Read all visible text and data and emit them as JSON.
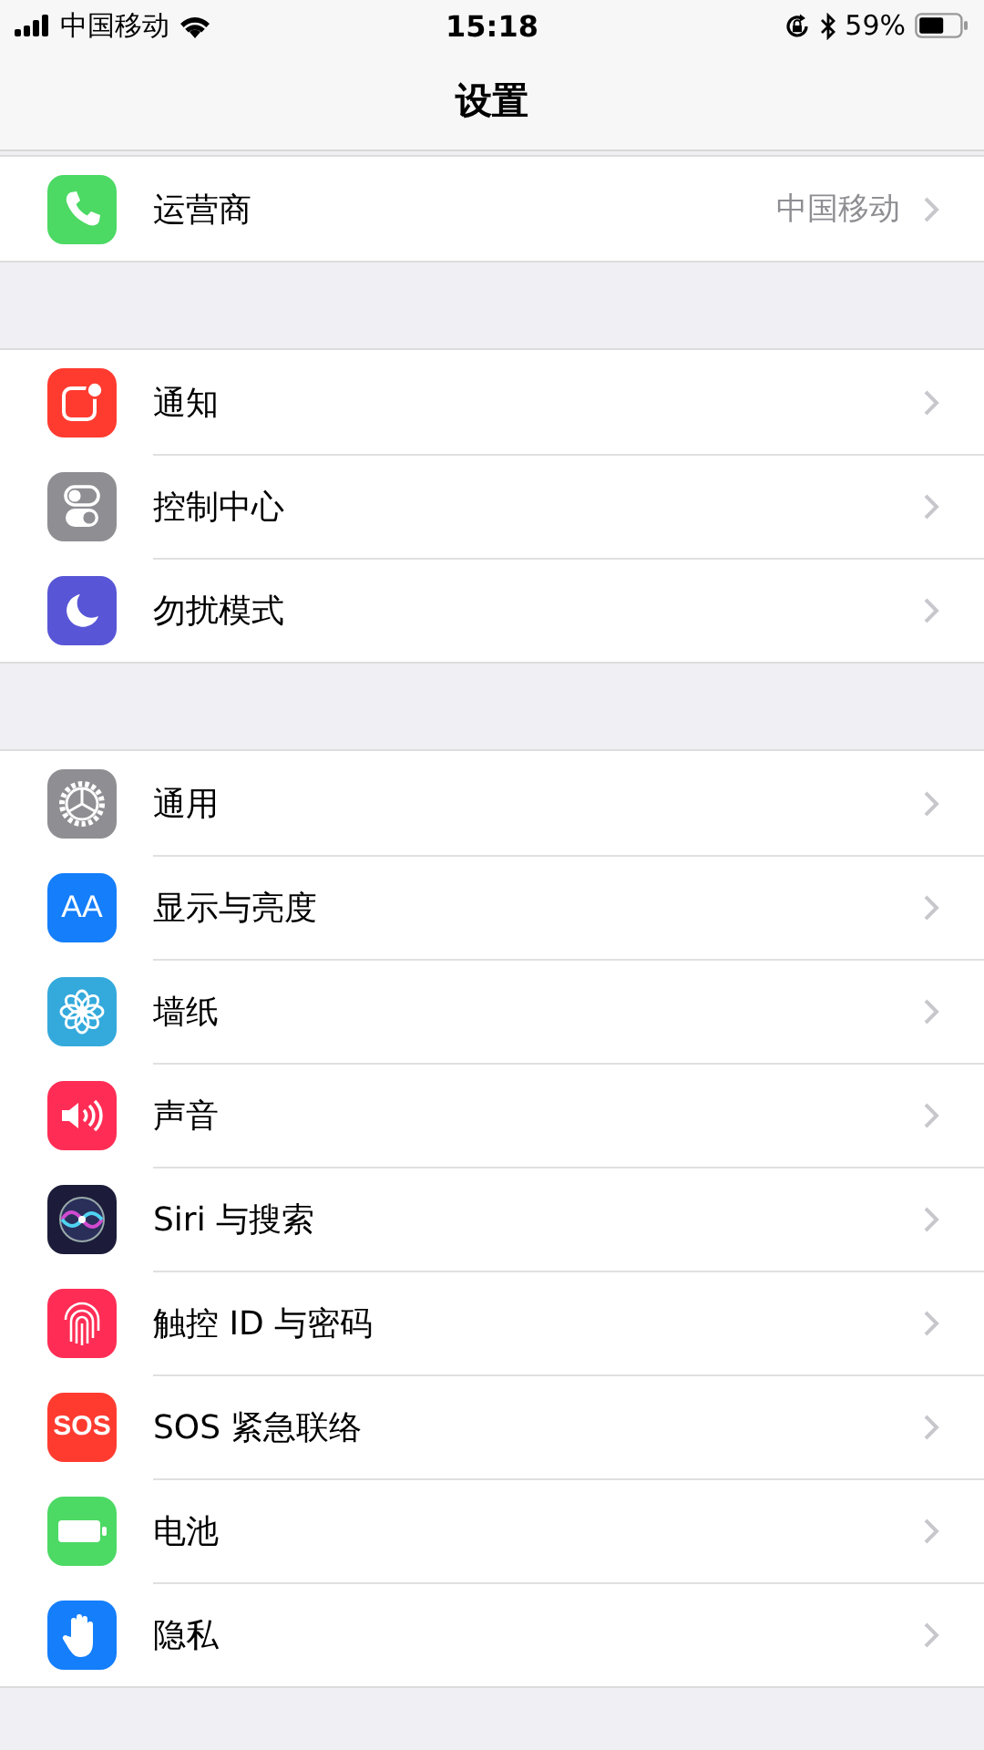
{
  "status_bar": {
    "carrier": "中国移动",
    "time": "15:18",
    "battery": "59%"
  },
  "nav": {
    "title": "设置"
  },
  "groups": [
    {
      "rows": [
        {
          "kind": "phone",
          "label": "运营商",
          "detail": "中国移动"
        }
      ]
    },
    {
      "rows": [
        {
          "kind": "notification",
          "label": "通知"
        },
        {
          "kind": "control",
          "label": "控制中心"
        },
        {
          "kind": "moon",
          "label": "勿扰模式"
        }
      ]
    },
    {
      "rows": [
        {
          "kind": "gear",
          "label": "通用"
        },
        {
          "kind": "display",
          "label": "显示与亮度",
          "icon_text": "AA"
        },
        {
          "kind": "flower",
          "label": "墙纸"
        },
        {
          "kind": "sound",
          "label": "声音"
        },
        {
          "kind": "siri",
          "label": "Siri 与搜索"
        },
        {
          "kind": "fingerprint",
          "label": "触控 ID 与密码"
        },
        {
          "kind": "sos",
          "label": "SOS 紧急联络",
          "icon_text": "SOS"
        },
        {
          "kind": "battery",
          "label": "电池"
        },
        {
          "kind": "hand",
          "label": "隐私"
        }
      ]
    }
  ]
}
